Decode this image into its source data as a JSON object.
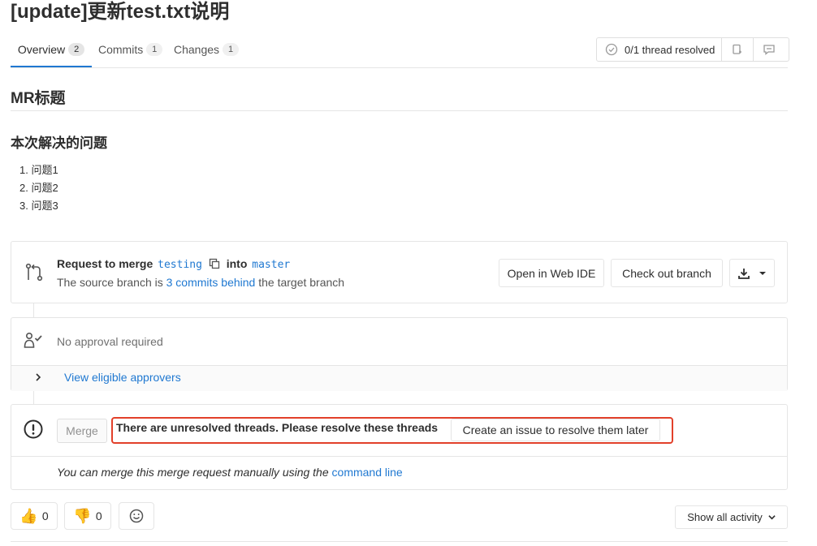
{
  "page": {
    "title": "[update]更新test.txt说明"
  },
  "tabs": [
    {
      "label": "Overview",
      "count": "2"
    },
    {
      "label": "Commits",
      "count": "1"
    },
    {
      "label": "Changes",
      "count": "1"
    }
  ],
  "threads": {
    "status": "0/1 thread resolved"
  },
  "description": {
    "heading": "MR标题",
    "subheading": "本次解决的问题",
    "items": [
      "问题1",
      "问题2",
      "问题3"
    ]
  },
  "merge_info": {
    "prefix": "Request to merge",
    "source_branch": "testing",
    "into": "into",
    "target_branch": "master",
    "behind_prefix": "The source branch is",
    "behind_link": "3 commits behind",
    "behind_suffix": "the target branch",
    "open_web_ide": "Open in Web IDE",
    "check_out_branch": "Check out branch"
  },
  "approvals": {
    "status": "No approval required",
    "view_link": "View eligible approvers"
  },
  "merge_widget": {
    "merge_button": "Merge",
    "unresolved_text": "There are unresolved threads. Please resolve these threads",
    "create_issue_button": "Create an issue to resolve them later",
    "manual_prefix": "You can merge this merge request manually using the",
    "command_line_link": "command line"
  },
  "awards": {
    "thumbsup_count": "0",
    "thumbsdown_count": "0"
  },
  "activity": {
    "filter_label": "Show all activity"
  },
  "colors": {
    "link": "#1f78d1",
    "highlight_border": "#e2402a",
    "border": "#e5e5e5"
  }
}
